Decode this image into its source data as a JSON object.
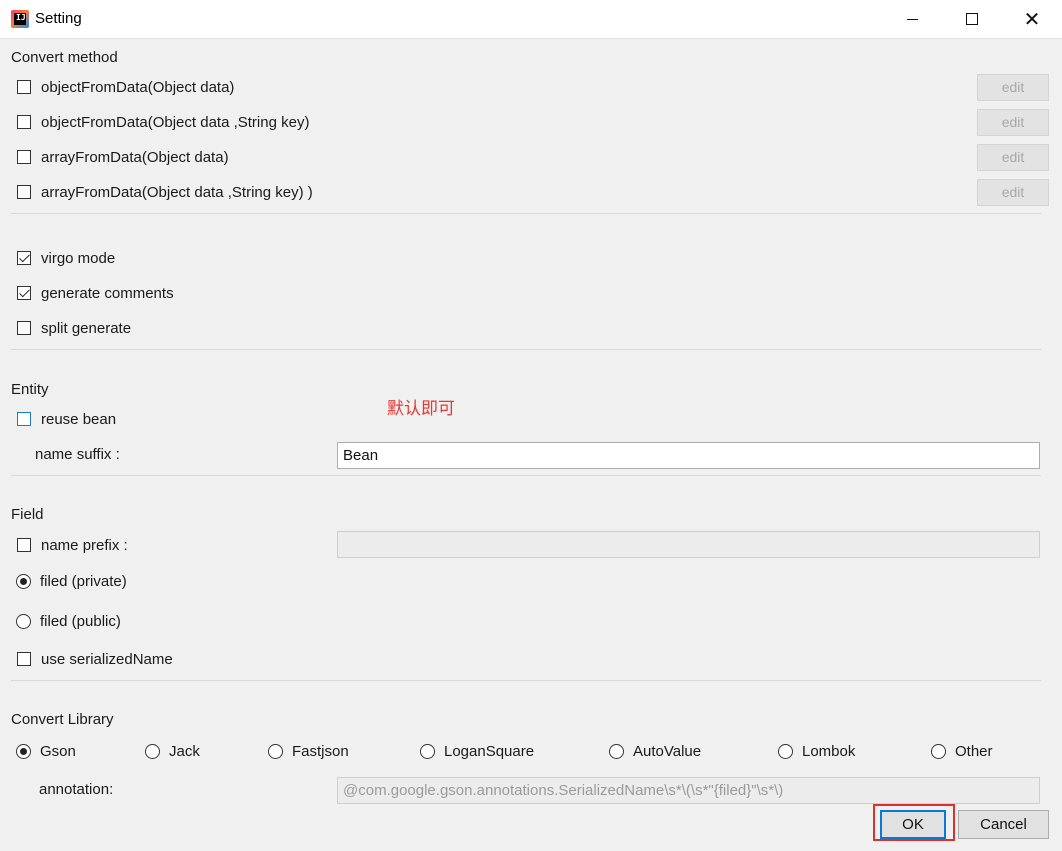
{
  "window": {
    "title": "Setting",
    "app_icon_text": "IJ"
  },
  "convert_method": {
    "label": "Convert method",
    "items": [
      {
        "label": "objectFromData(Object data)",
        "checked": false,
        "edit_label": "edit"
      },
      {
        "label": "objectFromData(Object data ,String key)",
        "checked": false,
        "edit_label": "edit"
      },
      {
        "label": "arrayFromData(Object data)",
        "checked": false,
        "edit_label": "edit"
      },
      {
        "label": "arrayFromData(Object data ,String key) )",
        "checked": false,
        "edit_label": "edit"
      }
    ]
  },
  "options": {
    "virgo_mode": {
      "label": "virgo mode",
      "checked": true
    },
    "generate_comments": {
      "label": "generate comments",
      "checked": true
    },
    "split_generate": {
      "label": "split generate",
      "checked": false
    }
  },
  "entity": {
    "label": "Entity",
    "reuse_bean": {
      "label": "reuse bean",
      "checked": false
    },
    "name_suffix_label": "name suffix :",
    "name_suffix_value": "Bean",
    "note": "默认即可"
  },
  "field": {
    "label": "Field",
    "name_prefix": {
      "label": "name prefix :",
      "checked": false,
      "value": ""
    },
    "filed_private": {
      "label": "filed (private)",
      "selected": true
    },
    "filed_public": {
      "label": "filed (public)",
      "selected": false
    },
    "use_serialized_name": {
      "label": "use serializedName",
      "checked": false
    }
  },
  "convert_library": {
    "label": "Convert Library",
    "options": [
      {
        "label": "Gson",
        "selected": true
      },
      {
        "label": "Jack",
        "selected": false
      },
      {
        "label": "Fastjson",
        "selected": false
      },
      {
        "label": "LoganSquare",
        "selected": false
      },
      {
        "label": "AutoValue",
        "selected": false
      },
      {
        "label": "Lombok",
        "selected": false
      },
      {
        "label": "Other",
        "selected": false
      }
    ],
    "annotation_label": "annotation:",
    "annotation_value": "@com.google.gson.annotations.SerializedName\\s*\\(\\s*\"{filed}\"\\s*\\)"
  },
  "buttons": {
    "ok": "OK",
    "cancel": "Cancel"
  },
  "colors": {
    "accent": "#0a78d7",
    "highlight_red": "#e0302a",
    "note_red": "#e53935"
  }
}
